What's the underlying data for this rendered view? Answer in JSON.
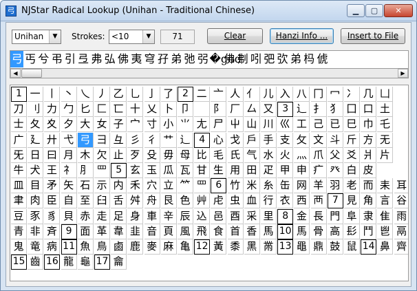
{
  "window": {
    "title": "NJStar Radical Lookup (Unihan - Traditional Chinese)",
    "icon": "弓",
    "controls": [
      "minimize-icon",
      "maximize-icon",
      "close-icon"
    ]
  },
  "toolbar": {
    "source_value": "Unihan",
    "strokes_label": "Strokes:",
    "strokes_value": "<10",
    "count": "71",
    "clear_label": "Clear",
    "hanzi_info_label": "Hanzi Info ...",
    "insert_label": "Insert to File"
  },
  "strip": {
    "selected_index": 0,
    "chars": [
      "弓",
      "丐",
      "兮",
      "弔",
      "引",
      "弖",
      "弗",
      "弘",
      "佛",
      "夷",
      "穹",
      "孖",
      "弟",
      "弛",
      "弜",
      "�god",
      "佛",
      "刜",
      "吲",
      "弝",
      "弞",
      "弟",
      "杩",
      "俿"
    ]
  },
  "grid": {
    "selected": "弓",
    "rows": [
      [
        "1",
        "一",
        "丨",
        "丶",
        "乀",
        "丿",
        "乙",
        "乚",
        "亅",
        "了",
        "2",
        "二",
        "亠",
        "人",
        "亻",
        "儿",
        "入",
        "八",
        "冂",
        "冖",
        "冫",
        "几",
        "凵"
      ],
      [
        "刀",
        "刂",
        "力",
        "勹",
        "匕",
        "匚",
        "匸",
        "十",
        "乂",
        "卜",
        "卩",
        "",
        "阝",
        "厂",
        "厶",
        "又",
        "3",
        "⻌",
        "扌",
        "犭",
        "囗",
        "口",
        "土"
      ],
      [
        "士",
        "夂",
        "夊",
        "夕",
        "大",
        "女",
        "子",
        "宀",
        "寸",
        "小",
        "⺌",
        "尢",
        "尸",
        "屮",
        "山",
        "川",
        "巛",
        "工",
        "己",
        "已",
        "巳",
        "巾",
        "乇"
      ],
      [
        "广",
        "廴",
        "廾",
        "弋",
        "弓",
        "彐",
        "彑",
        "彡",
        "彳",
        "艹",
        "辶",
        "4",
        "心",
        "戈",
        "戶",
        "手",
        "支",
        "攵",
        "文",
        "斗",
        "斤",
        "方",
        "无"
      ],
      [
        "旡",
        "日",
        "曰",
        "月",
        "木",
        "欠",
        "止",
        "歹",
        "殳",
        "毋",
        "母",
        "比",
        "毛",
        "氏",
        "气",
        "水",
        "火",
        "灬",
        "爪",
        "父",
        "爻",
        "爿",
        "片"
      ],
      [
        "牛",
        "犬",
        "王",
        "礻",
        "⺼",
        "罒",
        "5",
        "玄",
        "玉",
        "瓜",
        "瓦",
        "甘",
        "生",
        "用",
        "田",
        "疋",
        "甲",
        "申",
        "疒",
        "癶",
        "白",
        "皮"
      ],
      [
        "皿",
        "目",
        "矛",
        "矢",
        "石",
        "示",
        "内",
        "禾",
        "穴",
        "立",
        "⺮",
        "罒",
        "6",
        "竹",
        "米",
        "糸",
        "缶",
        "网",
        "羊",
        "羽",
        "老",
        "而",
        "耒",
        "耳"
      ],
      [
        "聿",
        "肉",
        "臣",
        "自",
        "至",
        "臼",
        "舌",
        "舛",
        "舟",
        "艮",
        "色",
        "艸",
        "虍",
        "虫",
        "血",
        "行",
        "衣",
        "西",
        "襾",
        "7",
        "見",
        "角",
        "言",
        "谷"
      ],
      [
        "豆",
        "豕",
        "豸",
        "貝",
        "赤",
        "走",
        "足",
        "身",
        "車",
        "辛",
        "辰",
        "込",
        "邑",
        "酉",
        "采",
        "里",
        "8",
        "金",
        "長",
        "門",
        "阜",
        "隶",
        "隹",
        "雨"
      ],
      [
        "青",
        "非",
        "斉",
        "9",
        "面",
        "革",
        "韋",
        "韭",
        "音",
        "頁",
        "風",
        "飛",
        "食",
        "首",
        "香",
        "馬",
        "10",
        "馬",
        "骨",
        "高",
        "髟",
        "鬥",
        "鬯",
        "鬲"
      ],
      [
        "鬼",
        "竜",
        "病",
        "11",
        "魚",
        "鳥",
        "鹵",
        "鹿",
        "麥",
        "麻",
        "亀",
        "12",
        "黃",
        "黍",
        "黑",
        "黹",
        "13",
        "黽",
        "鼎",
        "鼓",
        "鼠",
        "14",
        "鼻",
        "齊"
      ],
      [
        "15",
        "齒",
        "16",
        "龍",
        "龜",
        "17",
        "龠"
      ]
    ]
  }
}
